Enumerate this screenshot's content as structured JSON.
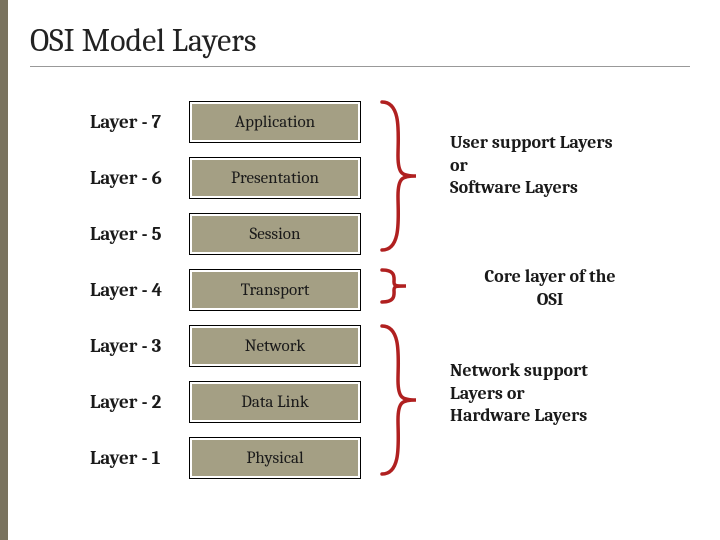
{
  "title": "OSI Model Layers",
  "layers": [
    {
      "num": "Layer - 7",
      "name": "Application"
    },
    {
      "num": "Layer - 6",
      "name": "Presentation"
    },
    {
      "num": "Layer - 5",
      "name": "Session"
    },
    {
      "num": "Layer - 4",
      "name": "Transport"
    },
    {
      "num": "Layer - 3",
      "name": "Network"
    },
    {
      "num": "Layer - 2",
      "name": "Data Link"
    },
    {
      "num": "Layer - 1",
      "name": "Physical"
    }
  ],
  "groups": {
    "upper": {
      "line1": "User support Layers",
      "line2": "or",
      "line3": "Software Layers"
    },
    "core": {
      "line1": "Core layer of the",
      "line2": "OSI"
    },
    "lower": {
      "line1": "Network support",
      "line2": "Layers or",
      "line3": "Hardware Layers"
    }
  },
  "colors": {
    "box": "#a49f84",
    "bracket": "#b02020",
    "accent": "#7a735f"
  }
}
